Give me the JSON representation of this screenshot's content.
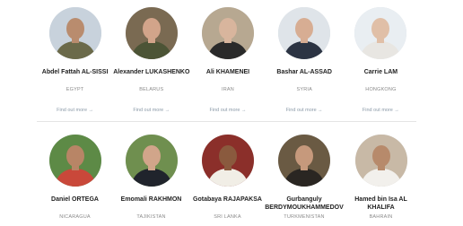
{
  "link_label": "Find out more →",
  "row1": [
    {
      "name": "Abdel Fattah AL-SISSI",
      "country": "EGYPT",
      "bg": "#c8d2dc",
      "face": "#b98c6e",
      "outfit": "#6b6a4a"
    },
    {
      "name": "Alexander LUKASHENKO",
      "country": "BELARUS",
      "bg": "#7a6a52",
      "face": "#d2a48a",
      "outfit": "#4c5436"
    },
    {
      "name": "Ali KHAMENEI",
      "country": "IRAN",
      "bg": "#b7a891",
      "face": "#d8b59d",
      "outfit": "#2a2a2a"
    },
    {
      "name": "Bashar AL-ASSAD",
      "country": "SYRIA",
      "bg": "#dfe4e9",
      "face": "#d7ad93",
      "outfit": "#2c3443"
    },
    {
      "name": "Carrie LAM",
      "country": "HONGKONG",
      "bg": "#e9eef2",
      "face": "#e0bfa7",
      "outfit": "#e8e6e2"
    }
  ],
  "row2": [
    {
      "name": "Daniel ORTEGA",
      "country": "NICARAGUA",
      "bg": "#5d8a46",
      "face": "#b88566",
      "outfit": "#c9483a"
    },
    {
      "name": "Emomali RAKHMON",
      "country": "TAJIKISTAN",
      "bg": "#6f8f4f",
      "face": "#d1a58a",
      "outfit": "#20242c"
    },
    {
      "name": "Gotabaya RAJAPAKSA",
      "country": "SRI LANKA",
      "bg": "#8b2f2a",
      "face": "#8a5a3e",
      "outfit": "#f1eee6"
    },
    {
      "name": "Gurbanguly BERDYMOUKHAMMEDOV",
      "country": "TURKMENISTAN",
      "bg": "#6a5a43",
      "face": "#c6997c",
      "outfit": "#2a2622"
    },
    {
      "name": "Hamed bin Isa AL KHALIFA",
      "country": "BAHRAIN",
      "bg": "#c8b9a6",
      "face": "#b78a6b",
      "outfit": "#f2f0ec"
    }
  ]
}
